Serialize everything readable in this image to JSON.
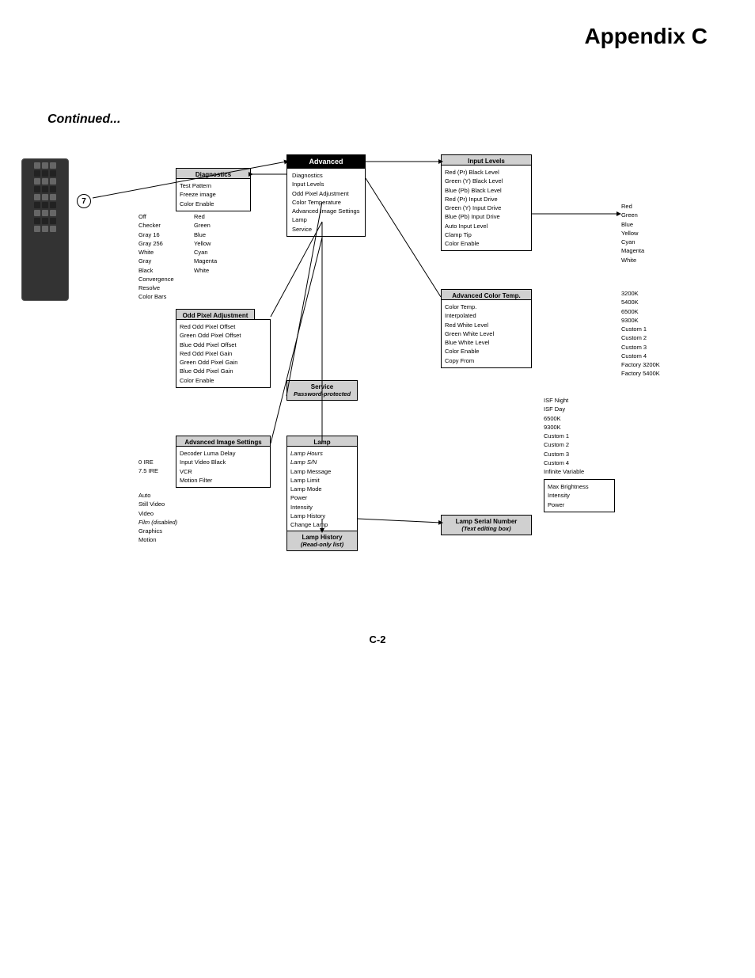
{
  "page": {
    "title": "Appendix C",
    "continued": "Continued...",
    "footer": "C-2"
  },
  "diagram": {
    "circle_label": "7",
    "boxes": {
      "advanced": {
        "label": "Advanced",
        "items": [
          "Diagnostics",
          "Input Levels",
          "Odd Pixel Adjustment",
          "Color Temperature",
          "Advanced Image Settings",
          "Lamp",
          "Service"
        ]
      },
      "diagnostics": {
        "label": "Diagnostics",
        "items": [
          "Test Pattern",
          "Freeze image",
          "Color Enable"
        ]
      },
      "diagnostics_colors": [
        "Red",
        "Green",
        "Blue",
        "Yellow",
        "Cyan",
        "Magenta",
        "White"
      ],
      "diagnostics_patterns": [
        "Off",
        "Checker",
        "Gray 16",
        "Gray 256",
        "White",
        "Gray",
        "Black",
        "Convergence",
        "Resolve",
        "Color Bars"
      ],
      "odd_pixel": {
        "label": "Odd Pixel Adjustment",
        "items": [
          "Red Odd Pixel Offset",
          "Green Odd Pixel Offset",
          "Blue Odd Pixel Offset",
          "Red Odd Pixel Gain",
          "Green Odd Pixel Gain",
          "Blue Odd Pixel Gain",
          "Color Enable"
        ]
      },
      "advanced_image": {
        "label": "Advanced Image Settings",
        "items": [
          "Decoder Luma Delay",
          "Input Video Black",
          "VCR",
          "Motion Filter"
        ]
      },
      "advanced_image_ire": [
        "0 IRE",
        "7.5 IRE"
      ],
      "motion_filter_values": [
        "Auto",
        "Still Video",
        "Video",
        "Film (disabled)",
        "Graphics",
        "Motion"
      ],
      "service": {
        "label": "Service",
        "note": "Password-protected"
      },
      "lamp": {
        "label": "Lamp",
        "items": [
          "Lamp Hours",
          "Lamp S/N",
          "Lamp Message",
          "Lamp Limit",
          "Lamp Mode",
          "Power",
          "Intensity",
          "Lamp History",
          "Change Lamp"
        ]
      },
      "lamp_history": {
        "label": "Lamp History",
        "note": "(Read-only list)"
      },
      "input_levels": {
        "label": "Input Levels",
        "items": [
          "Red (Pr) Black Level",
          "Green (Y) Black Level",
          "Blue (Pb) Black Level",
          "Red (Pr) Input Drive",
          "Green (Y) Input Drive",
          "Blue (Pb) Input Drive",
          "Auto Input Level",
          "Clamp Tip",
          "Color Enable"
        ]
      },
      "input_levels_colors": [
        "Red",
        "Green",
        "Blue",
        "Yellow",
        "Cyan",
        "Magenta",
        "White"
      ],
      "advanced_color_temp": {
        "label": "Advanced Color Temp.",
        "items": [
          "Color Temp.",
          "Interpolated",
          "Red White Level",
          "Green White Level",
          "Blue White Level",
          "Color Enable",
          "Copy From"
        ]
      },
      "color_temp_values": [
        "3200K",
        "5400K",
        "6500K",
        "9300K",
        "Custom 1",
        "Custom 2",
        "Custom 3",
        "Custom 4",
        "Factory 3200K",
        "Factory 5400K"
      ],
      "copy_from_values": [
        "ISF Night",
        "ISF Day",
        "6500K",
        "9300K",
        "Custom 1",
        "Custom 2",
        "Custom 3",
        "Custom 4",
        "Infinite Variable"
      ],
      "max_brightness": {
        "items": [
          "Max Brightness",
          "Intensity",
          "Power"
        ]
      },
      "lamp_serial": {
        "label": "Lamp Serial Number",
        "note": "(Text editing box)"
      }
    }
  }
}
